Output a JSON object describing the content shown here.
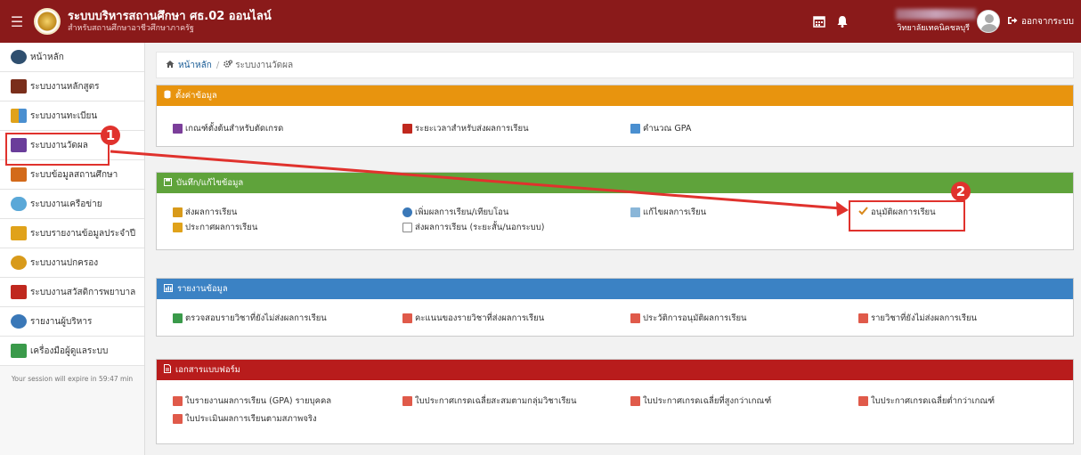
{
  "header": {
    "title": "ระบบบริหารสถานศึกษา ศธ.02 ออนไลน์",
    "subtitle": "สำหรับสถานศึกษาอาชีวศึกษาภาครัฐ",
    "college": "วิทยาลัยเทคนิคชลบุรี",
    "logout": "ออกจากระบบ",
    "menu_icon": "hamburger-icon",
    "calendar_icon": "calendar-icon",
    "bell_icon": "bell-icon",
    "logout_icon": "sign-out-icon"
  },
  "sidebar": {
    "items": [
      {
        "label": "หน้าหลัก",
        "icon": "dashboard-icon",
        "color": "#2f4f6f"
      },
      {
        "label": "ระบบงานหลักสูตร",
        "icon": "book-icon",
        "color": "#7a2e1b"
      },
      {
        "label": "ระบบงานทะเบียน",
        "icon": "users-icon",
        "color": "#4a8fd0"
      },
      {
        "label": "ระบบงานวัดผล",
        "icon": "calculator-icon",
        "color": "#6a3d9a"
      },
      {
        "label": "ระบบข้อมูลสถานศึกษา",
        "icon": "school-icon",
        "color": "#d36a1a"
      },
      {
        "label": "ระบบงานเครือข่าย",
        "icon": "cloud-icon",
        "color": "#5aa8d8"
      },
      {
        "label": "ระบบรายงานข้อมูลประจำปี",
        "icon": "report-icon",
        "color": "#e0a21a"
      },
      {
        "label": "ระบบงานปกครอง",
        "icon": "person-icon",
        "color": "#d89a1a"
      },
      {
        "label": "ระบบงานสวัสดิการพยาบาล",
        "icon": "first-aid-icon",
        "color": "#c0281e"
      },
      {
        "label": "รายงานผู้บริหาร",
        "icon": "manager-icon",
        "color": "#3a78b8"
      },
      {
        "label": "เครื่องมือผู้ดูแลระบบ",
        "icon": "admin-tools-icon",
        "color": "#3a9a4a"
      }
    ],
    "session": "Your session will expire in 59:47 min"
  },
  "breadcrumb": {
    "home": "หน้าหลัก",
    "separator": "/",
    "current": "ระบบงานวัดผล",
    "home_icon": "home-icon",
    "current_icon": "cogs-icon"
  },
  "panels": {
    "settings": {
      "title": "ตั้งค่าข้อมูล",
      "color": "#e8940e",
      "items": [
        "เกณฑ์ตั้งต้นสำหรับตัดเกรด",
        "ระยะเวลาสำหรับส่งผลการเรียน",
        "คำนวณ GPA"
      ]
    },
    "record": {
      "title": "บันทึก/แก้ไขข้อมูล",
      "color": "#5fa33b",
      "items": [
        "ส่งผลการเรียน",
        "เพิ่มผลการเรียน/เทียบโอน",
        "แก้ไขผลการเรียน",
        "อนุมัติผลการเรียน",
        "ประกาศผลการเรียน",
        "ส่งผลการเรียน (ระยะสั้น/นอกระบบ)"
      ]
    },
    "report": {
      "title": "รายงานข้อมูล",
      "color": "#3b82c4",
      "items": [
        "ตรวจสอบรายวิชาที่ยังไม่ส่งผลการเรียน",
        "คะแนนของรายวิชาที่ส่งผลการเรียน",
        "ประวัติการอนุมัติผลการเรียน",
        "รายวิชาที่ยังไม่ส่งผลการเรียน"
      ]
    },
    "forms": {
      "title": "เอกสารแบบฟอร์ม",
      "color": "#b81c1c",
      "items": [
        "ใบรายงานผลการเรียน (GPA) รายบุคคล",
        "ใบประกาศเกรดเฉลี่ยสะสมตามกลุ่มวิชาเรียน",
        "ใบประกาศเกรดเฉลี่ยที่สูงกว่าเกณฑ์",
        "ใบประกาศเกรดเฉลี่ยต่ำกว่าเกณฑ์",
        "ใบประเมินผลการเรียนตามสภาพจริง"
      ]
    }
  },
  "annotations": {
    "step1": "1",
    "step2": "2",
    "color": "#e0322d"
  }
}
